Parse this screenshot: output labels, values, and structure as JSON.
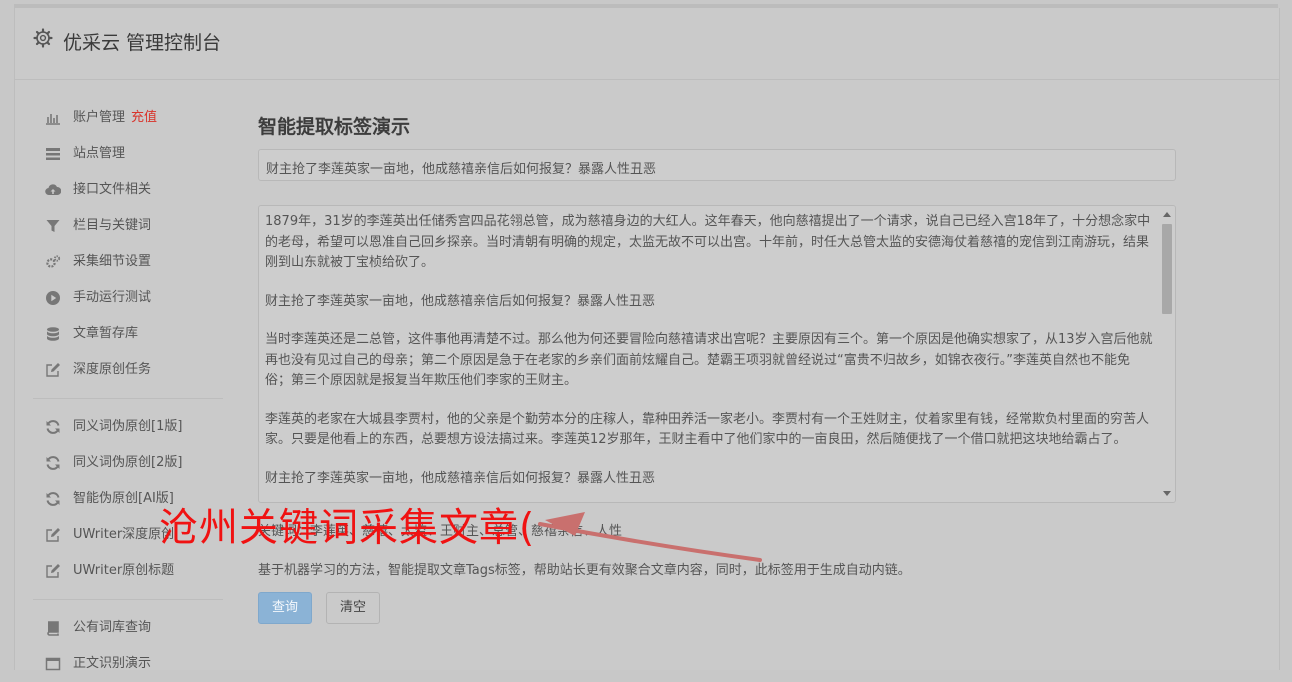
{
  "app": {
    "title": "优采云 管理控制台"
  },
  "sidebar": {
    "groups": [
      [
        {
          "label": "账户管理",
          "badge": "充值",
          "icon": "bar-chart-icon"
        },
        {
          "label": "站点管理",
          "icon": "list-icon"
        },
        {
          "label": "接口文件相关",
          "icon": "cloud-upload-icon"
        },
        {
          "label": "栏目与关键词",
          "icon": "filter-icon"
        },
        {
          "label": "采集细节设置",
          "icon": "gears-icon"
        },
        {
          "label": "手动运行测试",
          "icon": "play-circle-icon"
        },
        {
          "label": "文章暂存库",
          "icon": "database-icon"
        },
        {
          "label": "深度原创任务",
          "icon": "edit-icon"
        }
      ],
      [
        {
          "label": "同义词伪原创[1版]",
          "icon": "refresh-icon"
        },
        {
          "label": "同义词伪原创[2版]",
          "icon": "refresh-icon"
        },
        {
          "label": "智能伪原创[AI版]",
          "icon": "refresh-icon"
        },
        {
          "label": "UWriter深度原创",
          "icon": "edit-icon"
        },
        {
          "label": "UWriter原创标题",
          "icon": "edit-icon"
        }
      ],
      [
        {
          "label": "公有词库查询",
          "icon": "book-icon"
        },
        {
          "label": "正文识别演示",
          "icon": "window-icon"
        }
      ]
    ]
  },
  "main": {
    "title": "智能提取标签演示",
    "title_input": "财主抢了李莲英家一亩地，他成慈禧亲信后如何报复？暴露人性丑恶",
    "content_paragraphs": [
      "1879年，31岁的李莲英出任储秀宫四品花翎总管，成为慈禧身边的大红人。这年春天，他向慈禧提出了一个请求，说自己已经入宫18年了，十分想念家中的老母，希望可以恩准自己回乡探亲。当时清朝有明确的规定，太监无故不可以出宫。十年前，时任大总管太监的安德海仗着慈禧的宠信到江南游玩，结果刚到山东就被丁宝桢给砍了。",
      "财主抢了李莲英家一亩地，他成慈禧亲信后如何报复？暴露人性丑恶",
      "当时李莲英还是二总管，这件事他再清楚不过。那么他为何还要冒险向慈禧请求出宫呢？主要原因有三个。第一个原因是他确实想家了，从13岁入宫后他就再也没有见过自己的母亲；第二个原因是急于在老家的乡亲们面前炫耀自己。楚霸王项羽就曾经说过“富贵不归故乡，如锦衣夜行。”李莲英自然也不能免俗；第三个原因就是报复当年欺压他们李家的王财主。",
      "李莲英的老家在大城县李贾村，他的父亲是个勤劳本分的庄稼人，靠种田养活一家老小。李贾村有一个王姓财主，仗着家里有钱，经常欺负村里面的穷苦人家。只要是他看上的东西，总要想方设法搞过来。李莲英12岁那年，王财主看中了他们家中的一亩良田，然后随便找了一个借口就把这块地给霸占了。",
      "财主抢了李莲英家一亩地，他成慈禧亲信后如何报复？暴露人性丑恶"
    ],
    "tags_label": "关键词：李莲英、慈禧、太监、王财主、总管、慈禧亲信、人性",
    "description": "基于机器学习的方法，智能提取文章Tags标签，帮助站长更有效聚合文章内容，同时，此标签用于生成自动内链。",
    "query_button": "查询",
    "clear_button": "清空"
  },
  "watermark": {
    "text": "沧州关键词采集文章(",
    "color": "#f01212"
  }
}
